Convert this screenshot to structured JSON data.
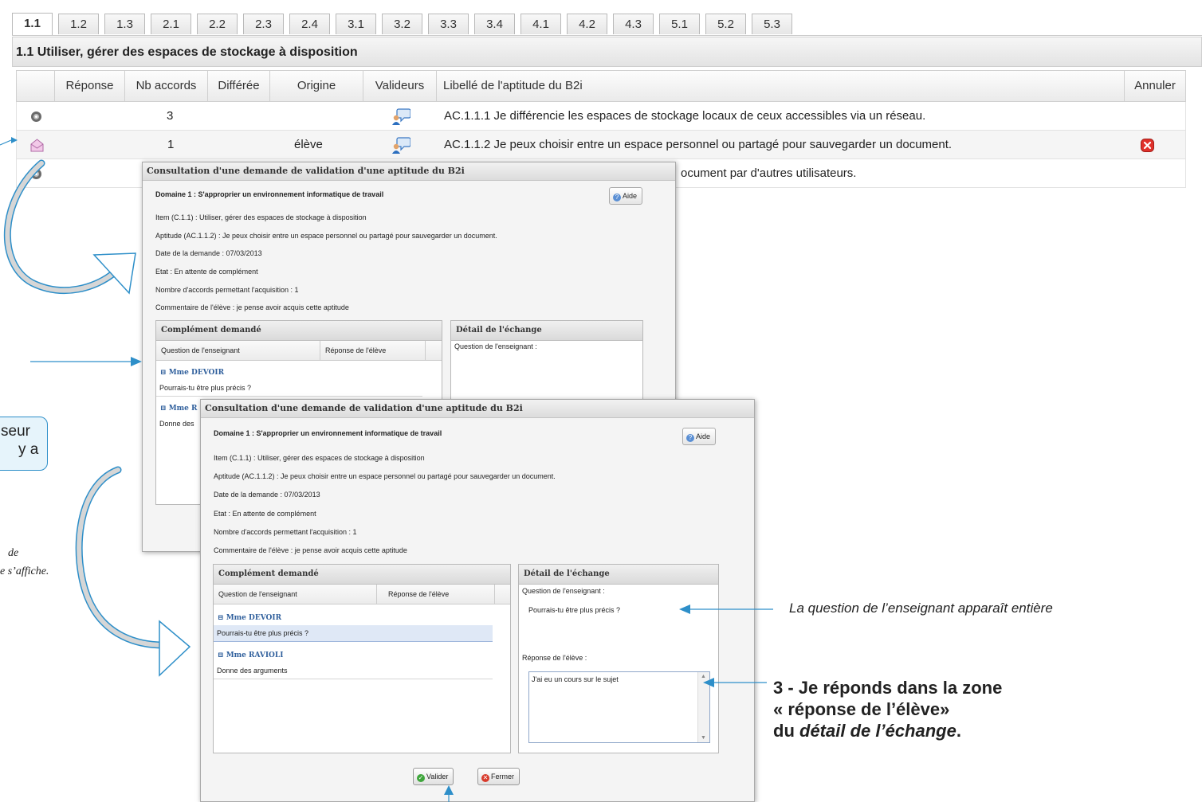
{
  "tabs": [
    "1.1",
    "1.2",
    "1.3",
    "2.1",
    "2.2",
    "2.3",
    "2.4",
    "3.1",
    "3.2",
    "3.3",
    "3.4",
    "4.1",
    "4.2",
    "4.3",
    "5.1",
    "5.2",
    "5.3"
  ],
  "section_title": "1.1 Utiliser, gérer des espaces de stockage à disposition",
  "table": {
    "headers": {
      "reponse": "Réponse",
      "nb_accords": "Nb accords",
      "differee": "Différée",
      "origine": "Origine",
      "valideurs": "Valideurs",
      "libelle": "Libellé de l'aptitude du B2i",
      "annuler": "Annuler"
    },
    "rows": [
      {
        "status_icon": "ring-icon",
        "nb_accords": "3",
        "origine": "",
        "libelle": "AC.1.1.1 Je différencie les espaces de stockage locaux de ceux accessibles via un réseau."
      },
      {
        "status_icon": "envelope-icon",
        "nb_accords": "1",
        "origine": "élève",
        "libelle": "AC.1.1.2 Je peux choisir entre un espace personnel ou partagé pour sauvegarder un document."
      },
      {
        "status_icon": "ring-icon",
        "nb_accords": "",
        "origine": "",
        "libelle": "ocument par d'autres utilisateurs."
      }
    ]
  },
  "dialog1": {
    "title": "Consultation d'une demande de validation d'une aptitude du B2i",
    "domain": "Domaine 1 : S'approprier un environnement informatique de travail",
    "aide_label": "Aide",
    "item": "Item (C.1.1) : Utiliser, gérer des espaces de stockage à disposition",
    "aptitude": "Aptitude (AC.1.1.2) : Je peux choisir entre un espace personnel ou partagé pour sauvegarder un document.",
    "date": "Date de la demande : 07/03/2013",
    "etat": "Etat : En attente de complément",
    "nombre": "Nombre d'accords permettant l'acquisition : 1",
    "commentaire": "Commentaire de l'élève :  je pense avoir acquis cette aptitude",
    "complement_title": "Complément demandé",
    "col_question": "Question de l'enseignant",
    "col_reponse": "Réponse de l'élève",
    "group1": "Mme DEVOIR",
    "q1": "Pourrais-tu être plus précis ?",
    "group2_partial": "Mme R",
    "q2_partial": "Donne des",
    "detail_title": "Détail de l'échange",
    "detail_question_label": "Question de l'enseignant :"
  },
  "dialog2": {
    "title": "Consultation d'une demande de validation d'une aptitude du B2i",
    "domain": "Domaine 1 : S'approprier un environnement informatique de travail",
    "aide_label": "Aide",
    "item": "Item (C.1.1) : Utiliser, gérer des espaces de stockage à disposition",
    "aptitude": "Aptitude (AC.1.1.2) : Je peux choisir entre un espace personnel ou partagé pour sauvegarder un document.",
    "date": "Date de la demande : 07/03/2013",
    "etat": "Etat : En attente de complément",
    "nombre": "Nombre d'accords permettant l'acquisition : 1",
    "commentaire": "Commentaire de l'élève :  je pense avoir acquis cette aptitude",
    "complement_title": "Complément demandé",
    "col_question": "Question de l'enseignant",
    "col_reponse": "Réponse de l'élève",
    "group1": "Mme DEVOIR",
    "q1": "Pourrais-tu être plus précis ?",
    "group2": "Mme RAVIOLI",
    "q2": "Donne des arguments",
    "detail_title": "Détail de l'échange",
    "detail_question_label": "Question de l'enseignant :",
    "detail_question_text": "Pourrais-tu être plus précis ?",
    "detail_reponse_label": "Réponse de l'élève :",
    "reponse_value": "J'ai eu un cours sur le sujet",
    "valider_label": "Valider",
    "fermer_label": "Fermer"
  },
  "annotations": {
    "callout_left_line1": "seur",
    "callout_left_line2": "y a",
    "note_left_line1": "de",
    "note_left_line2": "e s’affiche.",
    "note_right": "La question de l’enseignant apparaît entière",
    "step3_line1": "3 - Je réponds dans la zone",
    "step3_line2": "« réponse de l’élève»",
    "step3_line3_prefix": "du ",
    "step3_line3_em": "détail de l’échange",
    "step3_line3_suffix": "."
  },
  "colors": {
    "arrow": "#2e8fc9",
    "accent_blue": "#2f5f9c",
    "callout_bg": "#e6f4fb"
  }
}
